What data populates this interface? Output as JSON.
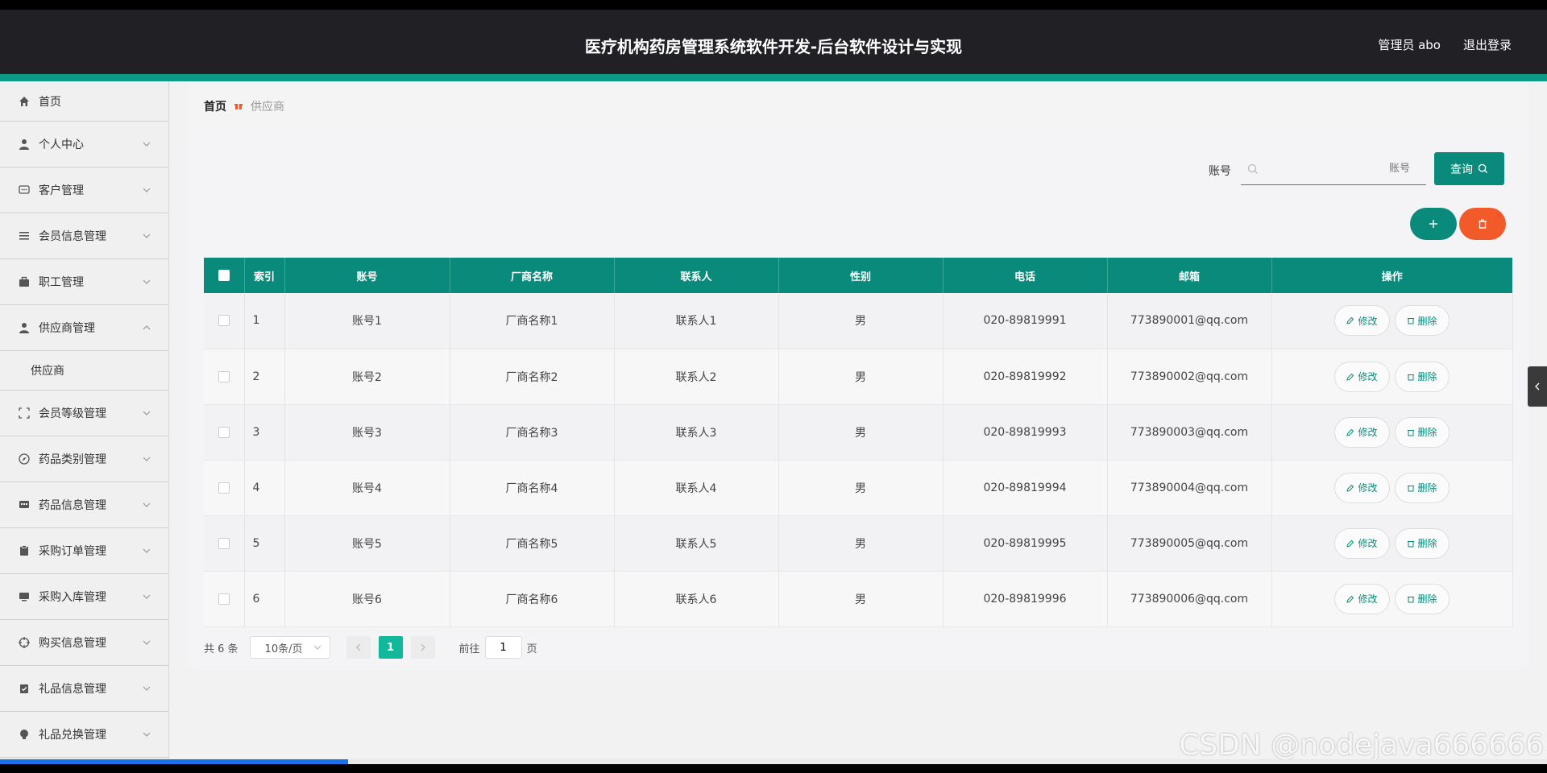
{
  "header": {
    "title": "医疗机构药房管理系统软件开发-后台软件设计与实现",
    "user": "管理员 abo",
    "logout": "退出登录"
  },
  "colors": {
    "primary": "#0a8a7a",
    "danger": "#f25a2a",
    "header": "#212024"
  },
  "sidebar": {
    "items": [
      {
        "label": "首页",
        "icon": "home-icon"
      },
      {
        "label": "个人中心",
        "icon": "user-icon"
      },
      {
        "label": "客户管理",
        "icon": "chat-icon"
      },
      {
        "label": "会员信息管理",
        "icon": "list-icon"
      },
      {
        "label": "职工管理",
        "icon": "briefcase-icon"
      },
      {
        "label": "供应商管理",
        "icon": "user-icon",
        "sub": "供应商"
      },
      {
        "label": "会员等级管理",
        "icon": "frame-icon"
      },
      {
        "label": "药品类别管理",
        "icon": "compass-icon"
      },
      {
        "label": "药品信息管理",
        "icon": "message-icon"
      },
      {
        "label": "采购订单管理",
        "icon": "clipboard-icon"
      },
      {
        "label": "采购入库管理",
        "icon": "monitor-icon"
      },
      {
        "label": "购买信息管理",
        "icon": "target-icon"
      },
      {
        "label": "礼品信息管理",
        "icon": "clipboard-check-icon"
      },
      {
        "label": "礼品兑换管理",
        "icon": "bulb-icon"
      }
    ]
  },
  "breadcrumb": {
    "home": "首页",
    "current": "供应商"
  },
  "search": {
    "label": "账号",
    "placeholder": "账号",
    "button": "查询"
  },
  "table": {
    "headers": [
      "索引",
      "账号",
      "厂商名称",
      "联系人",
      "性别",
      "电话",
      "邮箱",
      "操作"
    ],
    "rows": [
      [
        "1",
        "账号1",
        "厂商名称1",
        "联系人1",
        "男",
        "020-89819991",
        "773890001@qq.com"
      ],
      [
        "2",
        "账号2",
        "厂商名称2",
        "联系人2",
        "男",
        "020-89819992",
        "773890002@qq.com"
      ],
      [
        "3",
        "账号3",
        "厂商名称3",
        "联系人3",
        "男",
        "020-89819993",
        "773890003@qq.com"
      ],
      [
        "4",
        "账号4",
        "厂商名称4",
        "联系人4",
        "男",
        "020-89819994",
        "773890004@qq.com"
      ],
      [
        "5",
        "账号5",
        "厂商名称5",
        "联系人5",
        "男",
        "020-89819995",
        "773890005@qq.com"
      ],
      [
        "6",
        "账号6",
        "厂商名称6",
        "联系人6",
        "男",
        "020-89819996",
        "773890006@qq.com"
      ]
    ],
    "edit_label": "修改",
    "delete_label": "删除"
  },
  "pager": {
    "total": "共 6 条",
    "size": "10条/页",
    "current": "1",
    "goto": "前往",
    "goto_value": "1",
    "page": "页"
  },
  "watermark": "CSDN @nodejava666666"
}
